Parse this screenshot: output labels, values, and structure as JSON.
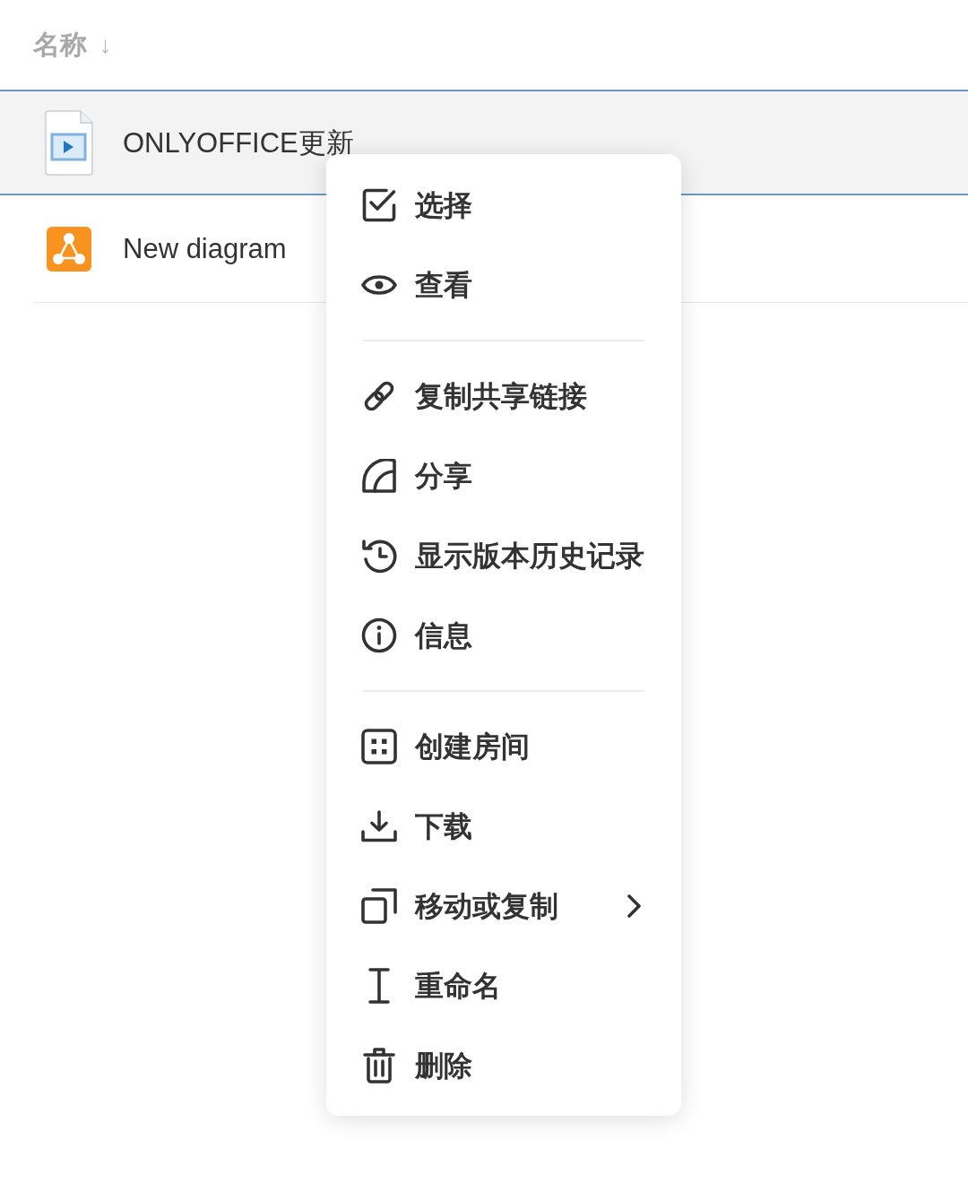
{
  "file_list": {
    "header": {
      "label": "名称",
      "arrow": "↓"
    },
    "rows": [
      {
        "name": "ONLYOFFICE更新",
        "kind": "video",
        "selected": true
      },
      {
        "name": "New diagram",
        "kind": "diagram",
        "selected": false
      }
    ]
  },
  "context_menu": {
    "sections": [
      {
        "items": [
          {
            "label": "选择",
            "kind": "select",
            "submenu": false
          },
          {
            "label": "查看",
            "kind": "view",
            "submenu": false
          }
        ]
      },
      {
        "items": [
          {
            "label": "复制共享链接",
            "kind": "link",
            "submenu": false
          },
          {
            "label": "分享",
            "kind": "share",
            "submenu": false
          },
          {
            "label": "显示版本历史记录",
            "kind": "history",
            "submenu": false
          },
          {
            "label": "信息",
            "kind": "info",
            "submenu": false
          }
        ]
      },
      {
        "items": [
          {
            "label": "创建房间",
            "kind": "room",
            "submenu": false
          },
          {
            "label": "下载",
            "kind": "download",
            "submenu": false
          },
          {
            "label": "移动或复制",
            "kind": "move",
            "submenu": true
          },
          {
            "label": "重命名",
            "kind": "rename",
            "submenu": false
          },
          {
            "label": "删除",
            "kind": "delete",
            "submenu": false
          }
        ]
      }
    ]
  }
}
